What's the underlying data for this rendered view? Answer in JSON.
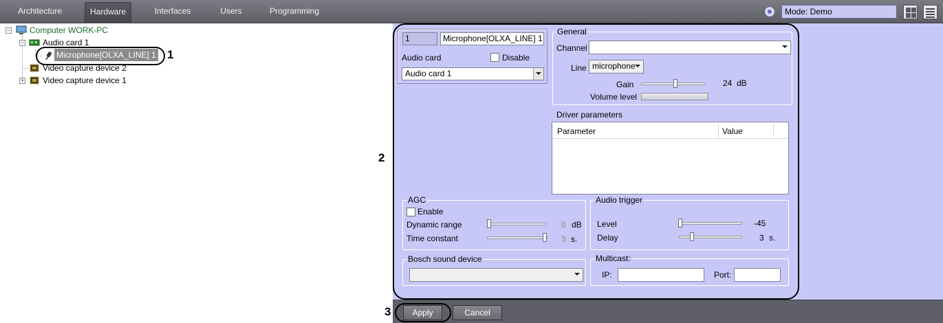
{
  "top_tabs": [
    {
      "label": "Architecture",
      "active": false
    },
    {
      "label": "Hardware",
      "active": true
    },
    {
      "label": "Interfaces",
      "active": false
    },
    {
      "label": "Users",
      "active": false
    },
    {
      "label": "Programming",
      "active": false
    }
  ],
  "mode": {
    "text": "Mode: Demo",
    "icon": "gear-circle-icon"
  },
  "tree": {
    "computer": "Computer WORK-PC",
    "audio_card": "Audio card 1",
    "microphone": "Microphone[OLXA_LINE] 1",
    "video2": "Video capture device 2",
    "video1": "Video capture device 1"
  },
  "object": {
    "id": "1",
    "name": "Microphone[OLXA_LINE] 1",
    "audio_card_label": "Audio card",
    "disable_label": "Disable",
    "audio_card_value": "Audio card 1"
  },
  "general": {
    "title": "General",
    "channel_label": "Channel",
    "channel_value": "",
    "line_label": "Line",
    "line_value": "microphone",
    "gain_label": "Gain",
    "gain_value": "24",
    "gain_unit": "dB",
    "volume_label": "Volume level"
  },
  "driver": {
    "title": "Driver parameters",
    "col_parameter": "Parameter",
    "col_value": "Value"
  },
  "agc": {
    "title": "AGC",
    "enable_label": "Enable",
    "dynamic_label": "Dynamic range",
    "dynamic_value": "0",
    "dynamic_unit": "dB",
    "time_label": "Time constant",
    "time_value": "3",
    "time_unit": "s."
  },
  "trigger": {
    "title": "Audio trigger",
    "level_label": "Level",
    "level_value": "-45",
    "delay_label": "Delay",
    "delay_value": "3",
    "delay_unit": "s."
  },
  "bosch": {
    "title": "Bosch sound device",
    "value": ""
  },
  "multicast": {
    "title": "Multicast:",
    "ip_label": "IP:",
    "ip_value": "",
    "port_label": "Port:",
    "port_value": ""
  },
  "buttons": {
    "apply": "Apply",
    "cancel": "Cancel"
  },
  "annotations": {
    "n1": "1",
    "n2": "2",
    "n3": "3"
  }
}
